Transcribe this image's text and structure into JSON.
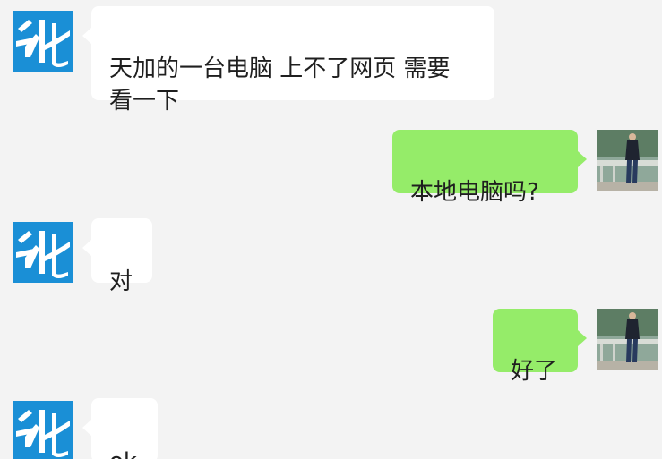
{
  "colors": {
    "background": "#f3f3f3",
    "incoming_bubble": "#ffffff",
    "outgoing_bubble": "#95ec69",
    "logo_blue": "#1a8fd6"
  },
  "messages": [
    {
      "sender": "contact",
      "avatar": "company-logo-icon",
      "text": "天加的一台电脑 上不了网页 需要\n看一下"
    },
    {
      "sender": "me",
      "avatar": "user-photo-avatar",
      "text": "本地电脑吗?"
    },
    {
      "sender": "contact",
      "avatar": "company-logo-icon",
      "text": "对"
    },
    {
      "sender": "me",
      "avatar": "user-photo-avatar",
      "text": "好了"
    },
    {
      "sender": "contact",
      "avatar": "company-logo-icon",
      "text": "ok"
    }
  ]
}
